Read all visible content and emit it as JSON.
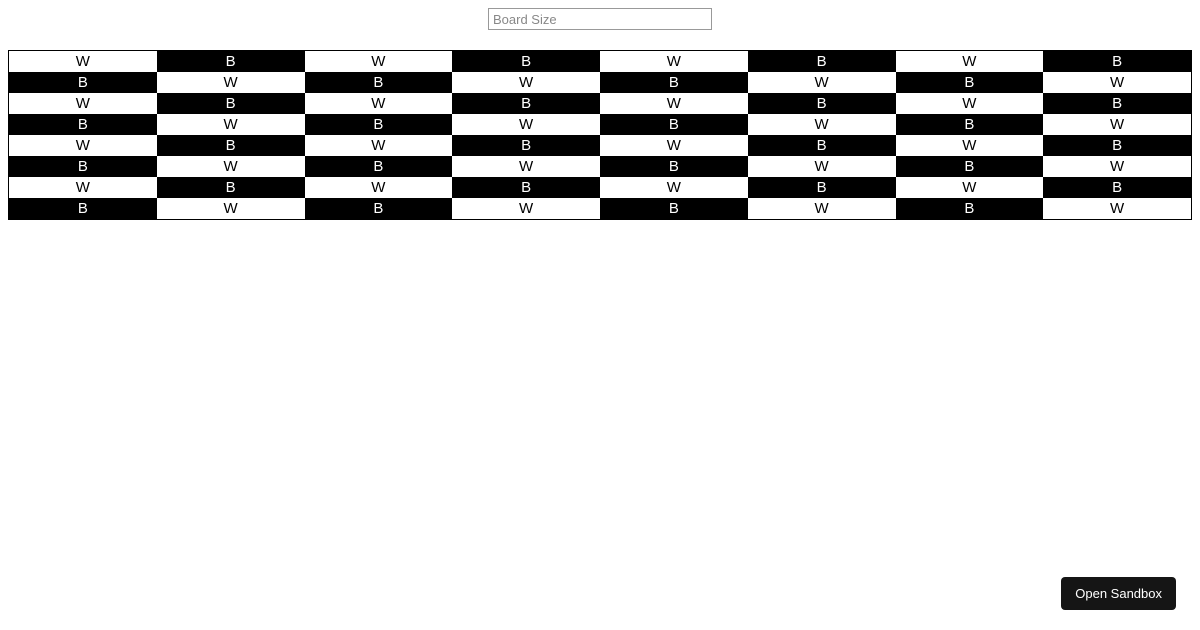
{
  "input": {
    "placeholder": "Board Size",
    "value": ""
  },
  "board": {
    "size": 8,
    "labels": {
      "white": "W",
      "black": "B"
    }
  },
  "sandbox_button": {
    "label": "Open Sandbox"
  }
}
